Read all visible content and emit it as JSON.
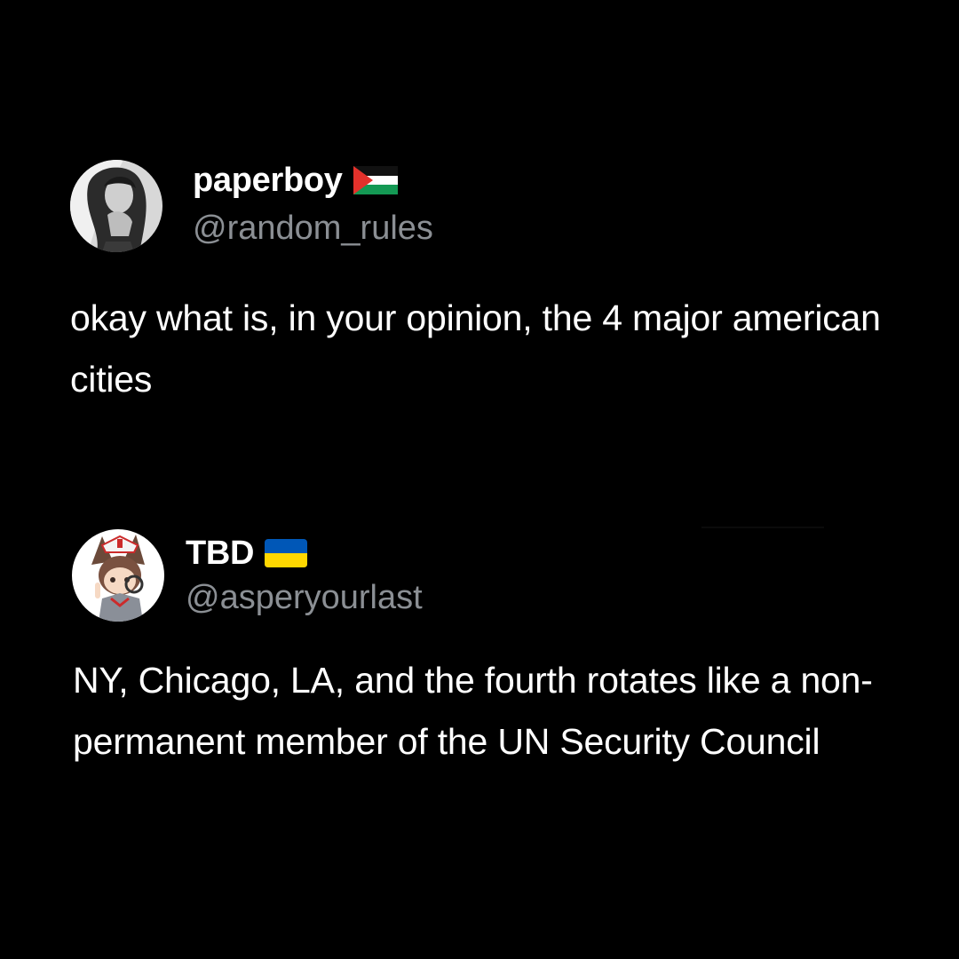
{
  "posts": [
    {
      "display_name": "paperboy",
      "flag": "palestine-flag-icon",
      "handle": "@random_rules",
      "text": "okay what is, in your opinion, the 4 major american cities"
    },
    {
      "display_name": "TBD",
      "flag": "ukraine-flag-icon",
      "handle": "@asperyourlast",
      "text": "NY, Chicago, LA, and the fourth rotates like a non-permanent member of the UN Security Council"
    }
  ],
  "colors": {
    "background": "#000000",
    "text": "#ffffff",
    "handle": "#8b8f94",
    "ukraine_blue": "#0057b7",
    "ukraine_yellow": "#ffd700",
    "palestine_red": "#e4312b",
    "palestine_green": "#149954"
  }
}
